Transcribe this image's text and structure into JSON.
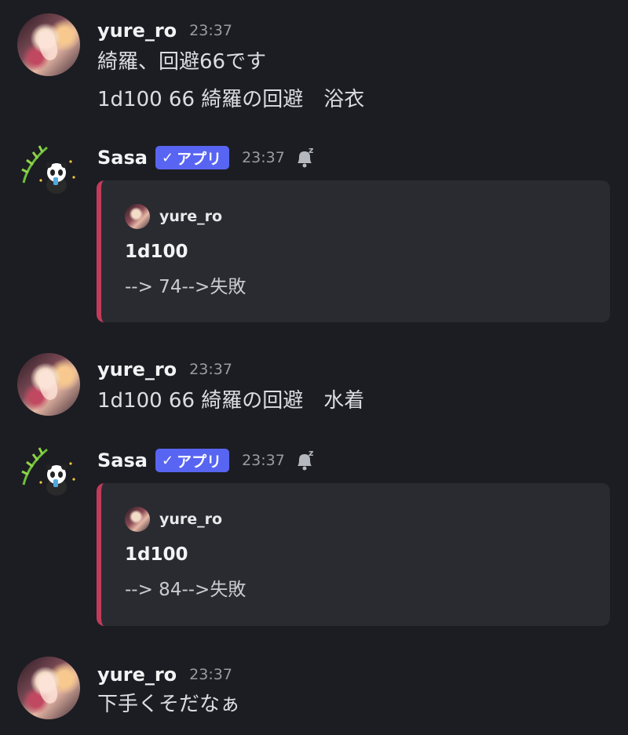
{
  "messages": [
    {
      "author": "yure_ro",
      "time": "23:37",
      "lines": [
        "綺羅、回避66です",
        "1d100 66 綺羅の回避　浴衣"
      ]
    },
    {
      "author": "Sasa",
      "badge": "アプリ",
      "time": "23:37",
      "embed": {
        "author": "yure_ro",
        "title": "1d100",
        "description": "--> 74-->失敗",
        "accent_color": "#c23b5b"
      }
    },
    {
      "author": "yure_ro",
      "time": "23:37",
      "lines": [
        "1d100 66 綺羅の回避　水着"
      ]
    },
    {
      "author": "Sasa",
      "badge": "アプリ",
      "time": "23:37",
      "embed": {
        "author": "yure_ro",
        "title": "1d100",
        "description": "--> 84-->失敗",
        "accent_color": "#c23b5b"
      }
    },
    {
      "author": "yure_ro",
      "time": "23:37",
      "lines": [
        "下手くそだなぁ"
      ]
    }
  ],
  "icons": {
    "bot_status": "sleeping-bell-icon",
    "badge_check": "checkmark-icon"
  },
  "colors": {
    "background": "#1c1d22",
    "badge": "#5865f2",
    "embed_background": "#2a2b30"
  }
}
